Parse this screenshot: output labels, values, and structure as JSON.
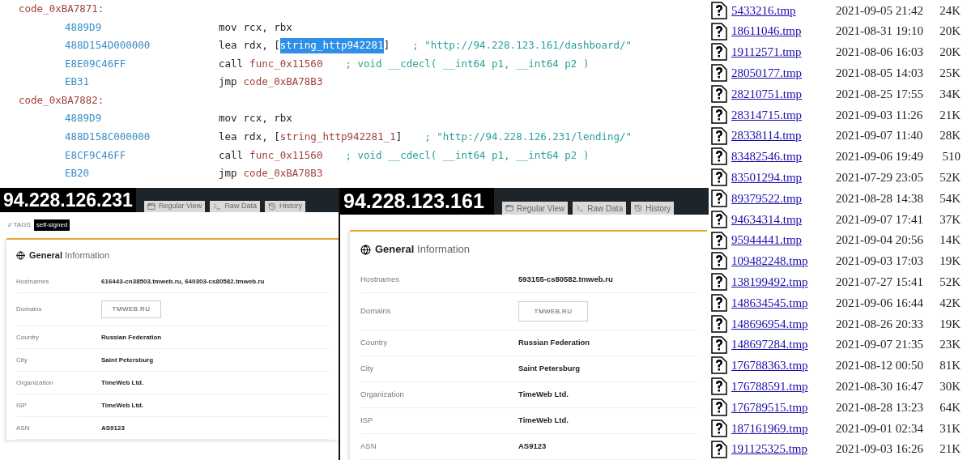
{
  "code_listing": {
    "lines": [
      {
        "kind": "label",
        "text": "code_0xBA7871:"
      },
      {
        "kind": "instr",
        "bytes": "4889D9",
        "mnemonic": "mov",
        "operands": [
          {
            "kind": "plain",
            "text": "rcx, rbx"
          }
        ]
      },
      {
        "kind": "instr",
        "bytes": "488D154D000000",
        "mnemonic": "lea",
        "operands": [
          {
            "kind": "plain",
            "text": "rdx, ["
          },
          {
            "kind": "ref",
            "text": "string_http942281",
            "selected": true
          },
          {
            "kind": "plain",
            "text": "]"
          }
        ],
        "comment": "; \"http://94.228.123.161/dashboard/\""
      },
      {
        "kind": "instr",
        "bytes": "E8E09C46FF",
        "mnemonic": "call",
        "operands": [
          {
            "kind": "ref",
            "text": "func_0x11560",
            "selected": false
          }
        ],
        "comment": "; void __cdecl( __int64 p1, __int64 p2 )"
      },
      {
        "kind": "instr",
        "bytes": "EB31",
        "mnemonic": "jmp",
        "operands": [
          {
            "kind": "ref",
            "text": "code_0xBA78B3",
            "selected": false
          }
        ]
      },
      {
        "kind": "label",
        "text": "code_0xBA7882:"
      },
      {
        "kind": "instr",
        "bytes": "4889D9",
        "mnemonic": "mov",
        "operands": [
          {
            "kind": "plain",
            "text": "rcx, rbx"
          }
        ]
      },
      {
        "kind": "instr",
        "bytes": "488D158C000000",
        "mnemonic": "lea",
        "operands": [
          {
            "kind": "plain",
            "text": "rdx, ["
          },
          {
            "kind": "ref",
            "text": "string_http942281_1",
            "selected": false
          },
          {
            "kind": "plain",
            "text": "]"
          }
        ],
        "comment": "; \"http://94.228.126.231/lending/\""
      },
      {
        "kind": "instr",
        "bytes": "E8CF9C46FF",
        "mnemonic": "call",
        "operands": [
          {
            "kind": "ref",
            "text": "func_0x11560",
            "selected": false
          }
        ],
        "comment": "; void __cdecl( __int64 p1, __int64 p2 )"
      },
      {
        "kind": "instr",
        "bytes": "EB20",
        "mnemonic": "jmp",
        "operands": [
          {
            "kind": "ref",
            "text": "code_0xBA78B3",
            "selected": false
          }
        ]
      }
    ]
  },
  "panels": [
    {
      "ip": "94.228.126.231",
      "tabs": [
        {
          "kind": "window",
          "label": "Regular View"
        },
        {
          "kind": "terminal",
          "label": "Raw Data"
        },
        {
          "kind": "history",
          "label": "History"
        }
      ],
      "tags": {
        "label": "// TAGS",
        "items": [
          "self-signed"
        ]
      },
      "card": {
        "title_bold": "General",
        "title_rest": "Information",
        "rows": [
          {
            "kind": "text",
            "label": "Hostnames",
            "value": "616443-cn38503.tmweb.ru, 640303-cs80582.tmweb.ru"
          },
          {
            "kind": "chip",
            "label": "Domains",
            "value": "TMWEB.RU"
          },
          {
            "kind": "text",
            "label": "Country",
            "value": "Russian Federation"
          },
          {
            "kind": "text",
            "label": "City",
            "value": "Saint Petersburg"
          },
          {
            "kind": "text",
            "label": "Organization",
            "value": "TimeWeb Ltd."
          },
          {
            "kind": "text",
            "label": "ISP",
            "value": "TimeWeb Ltd."
          },
          {
            "kind": "text",
            "label": "ASN",
            "value": "AS9123"
          }
        ]
      }
    },
    {
      "ip": "94.228.123.161",
      "tabs": [
        {
          "kind": "window",
          "label": "Regular View"
        },
        {
          "kind": "terminal",
          "label": "Raw Data"
        },
        {
          "kind": "history",
          "label": "History"
        }
      ],
      "card": {
        "title_bold": "General",
        "title_rest": "Information",
        "rows": [
          {
            "kind": "text",
            "label": "Hostnames",
            "value": "593155-cs80582.tmweb.ru"
          },
          {
            "kind": "chip",
            "label": "Domains",
            "value": "TMWEB.RU"
          },
          {
            "kind": "text",
            "label": "Country",
            "value": "Russian Federation"
          },
          {
            "kind": "text",
            "label": "City",
            "value": "Saint Petersburg"
          },
          {
            "kind": "text",
            "label": "Organization",
            "value": "TimeWeb Ltd."
          },
          {
            "kind": "text",
            "label": "ISP",
            "value": "TimeWeb Ltd."
          },
          {
            "kind": "text",
            "label": "ASN",
            "value": "AS9123"
          }
        ]
      }
    }
  ],
  "file_listing": {
    "rows": [
      {
        "name": "5433216.tmp",
        "date": "2021-09-05 21:42",
        "size": "24K"
      },
      {
        "name": "18611046.tmp",
        "date": "2021-08-31 19:10",
        "size": "20K"
      },
      {
        "name": "19112571.tmp",
        "date": "2021-08-06 16:03",
        "size": "20K"
      },
      {
        "name": "28050177.tmp",
        "date": "2021-08-05 14:03",
        "size": "25K"
      },
      {
        "name": "28210751.tmp",
        "date": "2021-08-25 17:55",
        "size": "34K"
      },
      {
        "name": "28314715.tmp",
        "date": "2021-09-03 11:26",
        "size": "21K"
      },
      {
        "name": "28338114.tmp",
        "date": "2021-09-07 11:40",
        "size": "28K"
      },
      {
        "name": "83482546.tmp",
        "date": "2021-09-06 19:49",
        "size": "510"
      },
      {
        "name": "83501294.tmp",
        "date": "2021-07-29 23:05",
        "size": "52K"
      },
      {
        "name": "89379522.tmp",
        "date": "2021-08-28 14:38",
        "size": "54K"
      },
      {
        "name": "94634314.tmp",
        "date": "2021-09-07 17:41",
        "size": "37K"
      },
      {
        "name": "95944441.tmp",
        "date": "2021-09-04 20:56",
        "size": "14K"
      },
      {
        "name": "109482248.tmp",
        "date": "2021-09-03 17:03",
        "size": "19K"
      },
      {
        "name": "138199492.tmp",
        "date": "2021-07-27 15:41",
        "size": "52K"
      },
      {
        "name": "148634545.tmp",
        "date": "2021-09-06 16:44",
        "size": "42K"
      },
      {
        "name": "148696954.tmp",
        "date": "2021-08-26 20:33",
        "size": "19K"
      },
      {
        "name": "148697284.tmp",
        "date": "2021-09-07 21:35",
        "size": "23K"
      },
      {
        "name": "176788363.tmp",
        "date": "2021-08-12 00:50",
        "size": "81K"
      },
      {
        "name": "176788591.tmp",
        "date": "2021-08-30 16:47",
        "size": "30K"
      },
      {
        "name": "176789515.tmp",
        "date": "2021-08-28 13:23",
        "size": "64K"
      },
      {
        "name": "187161969.tmp",
        "date": "2021-09-01 02:34",
        "size": "31K"
      },
      {
        "name": "191125325.tmp",
        "date": "2021-09-03 16:26",
        "size": "21K"
      }
    ]
  }
}
